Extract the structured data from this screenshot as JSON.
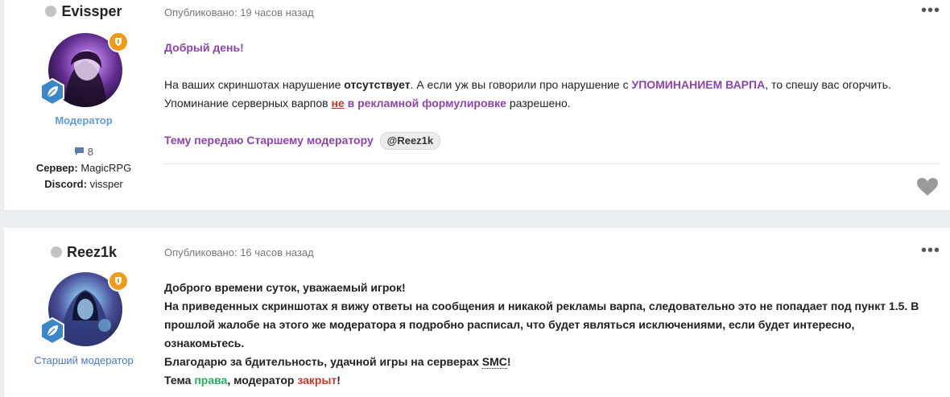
{
  "posts": [
    {
      "author": "Evissper",
      "role": "Модератор",
      "reputation_count": "8",
      "server_label": "Сервер:",
      "server_value": "MagicRPG",
      "discord_label": "Discord:",
      "discord_value": "vissper",
      "published": "Опубликовано: 19 часов назад",
      "greeting": "Добрый день!",
      "p1_a": "На ваших скриншотах нарушение ",
      "p1_b": "отсутствует",
      "p1_c": ". А если уж вы говорили про нарушение с ",
      "p1_d": "УПОМИНАНИЕМ ВАРПА",
      "p1_e": ", то спешу вас огорчить.",
      "p2_a": "Упоминание серверных варпов ",
      "p2_b": "не",
      "p2_c": " в рекламной формулировке",
      "p2_d": " разрешено.",
      "transfer": "Тему передаю Старшему модератору",
      "mention": "@Reez1k"
    },
    {
      "author": "Reez1k",
      "role": "Старший модератор",
      "published": "Опубликовано: 16 часов назад",
      "l1": "Доброго времени суток, уважаемый игрок!",
      "l2": "На приведенных скриншотах я вижу ответы на сообщения и никакой рекламы варпа, следовательно это не попадает под пункт 1.5. В прошлой жалобе на этого же модератора я подробно расписал, что будет являться исключениями, если будет интересно, ознакомьтесь.",
      "l3_a": "Благодарю за бдительность, удачной игры на серверах ",
      "l3_b": "SMC",
      "l3_c": "!",
      "l4_a": "Тема ",
      "l4_b": "права",
      "l4_c": ", модератор ",
      "l4_d": "закрыт",
      "l4_e": "!"
    }
  ],
  "ui": {
    "more_icon": "ellipsis-icon",
    "like_icon": "heart-icon",
    "comment_icon": "speech-bubble-icon",
    "badge_top_icon": "shield-badge-icon",
    "badge_leaf_icon": "leaf-badge-icon"
  },
  "colors": {
    "purple": "#8e44ad",
    "red": "#c0392b",
    "green": "#27ae60",
    "role_blue": "#5f9bd8"
  }
}
